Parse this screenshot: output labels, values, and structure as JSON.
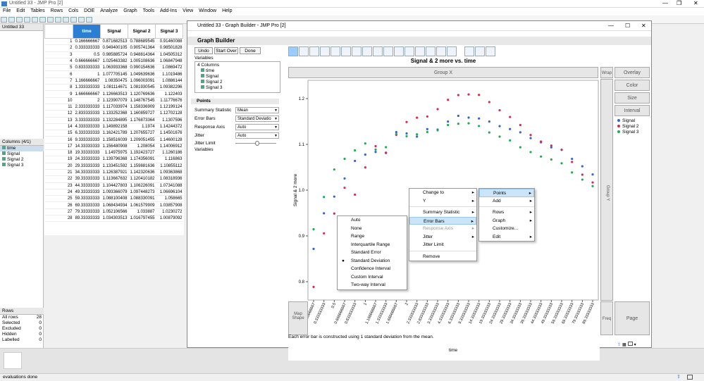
{
  "app": {
    "title": "Untitled 33 - JMP Pro [2]",
    "menus": [
      "File",
      "Edit",
      "Tables",
      "Rows",
      "Cols",
      "DOE",
      "Analyze",
      "Graph",
      "Tools",
      "Add-Ins",
      "View",
      "Window",
      "Help"
    ],
    "status": "evaluations done"
  },
  "left": {
    "table_name": "Untitled 33",
    "columns_header": "Columns (4/1)",
    "columns": [
      "time",
      "Signal",
      "Signal 2",
      "Signal 3"
    ],
    "rows_header": "Rows",
    "rows_stats": [
      {
        "label": "All rows",
        "value": "28"
      },
      {
        "label": "Selected",
        "value": "0"
      },
      {
        "label": "Excluded",
        "value": "0"
      },
      {
        "label": "Hidden",
        "value": "0"
      },
      {
        "label": "Labelled",
        "value": "0"
      }
    ]
  },
  "table": {
    "headers": [
      "time",
      "Signal",
      "Signal 2",
      "Signal 3"
    ],
    "rows": [
      [
        "0.166666667",
        "0.871682513",
        "0.788689545",
        "0.91460088"
      ],
      [
        "0.333333333",
        "0.949400105",
        "0.905741364",
        "0.98501828"
      ],
      [
        "0.5",
        "0.985885724",
        "0.948814364",
        "1.04505312"
      ],
      [
        "0.666666667",
        "1.025463382",
        "1.005108636",
        "1.06847948"
      ],
      [
        "0.833333333",
        "1.063933368",
        "0.990154636",
        "1.0869472"
      ],
      [
        "1",
        "1.077705145",
        "1.049639636",
        "1.1019486"
      ],
      [
        "1.166666667",
        "1.08350475",
        "1.096003091",
        "1.0886144"
      ],
      [
        "1.333333333",
        "1.081114671",
        "1.081930545",
        "1.09382296"
      ],
      [
        "1.666666667",
        "1.126663513",
        "1.120769636",
        "1.122403"
      ],
      [
        "2",
        "1.123907079",
        "1.148767545",
        "1.11776676"
      ],
      [
        "2.333333333",
        "1.117033974",
        "1.158336909",
        "1.12199124"
      ],
      [
        "2.833333333",
        "1.133252368",
        "1.160859727",
        "1.12702128"
      ],
      [
        "3.333333333",
        "1.132284895",
        "1.176873364",
        "1.1307596"
      ],
      [
        "4.333333333",
        "1.149892158",
        "1.1974",
        "1.14244372"
      ],
      [
        "6.333333333",
        "1.162421789",
        "1.207655727",
        "1.14501676"
      ],
      [
        "9.333333333",
        "1.158516039",
        "1.209051455",
        "1.14600128"
      ],
      [
        "14.33333333",
        "1.156480908",
        "1.208054",
        "1.14006912"
      ],
      [
        "19.33333333",
        "1.14975975",
        "1.192423727",
        "1.1260186"
      ],
      [
        "24.33333333",
        "1.139796368",
        "1.174356091",
        "1.116863"
      ],
      [
        "29.33333333",
        "1.133451592",
        "1.159881636",
        "1.10855112"
      ],
      [
        "34.33333333",
        "1.126387921",
        "1.142320636",
        "1.09363868"
      ],
      [
        "39.33333333",
        "1.113667632",
        "1.120410182",
        "1.08318936"
      ],
      [
        "44.33333333",
        "1.104427803",
        "1.106226091",
        "1.07341088"
      ],
      [
        "49.33333333",
        "1.093366079",
        "1.097448273",
        "1.06696104"
      ],
      [
        "59.33333333",
        "1.088100408",
        "1.088330091",
        "1.058665"
      ],
      [
        "69.33333333",
        "1.068434934",
        "1.061579909",
        "1.03857908"
      ],
      [
        "79.33333333",
        "1.052106566",
        "1.033887",
        "1.0230272"
      ],
      [
        "89.33333333",
        "1.034303513",
        "1.016797455",
        "1.00879092"
      ]
    ]
  },
  "gb": {
    "window_title": "Untitled 33 - Graph Builder - JMP Pro [2]",
    "header": "Graph Builder",
    "buttons": [
      "Undo",
      "Start Over",
      "Done"
    ],
    "variables_label": "Variables",
    "columns_label": "4 Columns",
    "var_list": [
      "time",
      "Signal",
      "Signal 2",
      "Signal 3"
    ],
    "points_header": "Points",
    "props": [
      {
        "label": "Summary Statistic",
        "value": "Mean"
      },
      {
        "label": "Error Bars",
        "value": "Standard Deviatio"
      },
      {
        "label": "Response Axis",
        "value": "Auto"
      },
      {
        "label": "Jitter",
        "value": "Auto"
      },
      {
        "label": "Jitter Limit",
        "value": ""
      },
      {
        "label": "Variables",
        "value": ""
      }
    ],
    "chart_title": "Signal & 2 more vs. time",
    "group_x": "Group X",
    "group_y": "Group Y",
    "wrap": "Wrap",
    "freq": "Freq",
    "page": "Page",
    "map_shape": "Map Shape",
    "side_buttons": [
      "Overlay",
      "Color",
      "Size",
      "Interval"
    ],
    "footer_note": "Each error bar is constructed using 1 standard deviation from the mean."
  },
  "chart_data": {
    "type": "scatter",
    "title": "Signal & 2 more vs. time",
    "xlabel": "time",
    "ylabel": "Signal & 2 more",
    "x_categories": [
      "0.166666667",
      "0.333333333",
      "0.5",
      "0.666666667",
      "0.833333333",
      "1",
      "1.166666667",
      "1.333333333",
      "1.666666667",
      "2",
      "2.333333333",
      "2.833333333",
      "3.333333333",
      "4.333333333",
      "6.333333333",
      "9.333333333",
      "14.33333333",
      "19.33333333",
      "24.33333333",
      "29.33333333",
      "34.33333333",
      "39.33333333",
      "44.33333333",
      "49.33333333",
      "59.33333333",
      "69.33333333",
      "79.33333333",
      "89.33333333"
    ],
    "x_tick_labels": [
      "0.166666667",
      "0.333333333",
      "0.5",
      "0.666666667",
      "0.833333333",
      "1",
      "1.166666667",
      "1.333333333",
      "1.666666667",
      "2",
      "2.333333333",
      "2.833333333",
      "3.333333333",
      "4.333333333",
      "6.333333333",
      "9.333333333",
      "14.33333333",
      "19.33333333",
      "24.33333333",
      "29.33333333",
      "34.33333333",
      "39.33333333",
      "44.33333333",
      "49.33333333",
      "59.33333333",
      "69.33333333",
      "79.33333333",
      "89.33333333"
    ],
    "y_ticks": [
      "0.8",
      "0.9",
      "1.0",
      "1.1",
      "1.2"
    ],
    "ylim": [
      0.76,
      1.24
    ],
    "legend_position": "right",
    "series": [
      {
        "name": "Signal",
        "color": "#3366cc",
        "values": [
          0.8717,
          0.9494,
          0.9859,
          1.0255,
          1.0639,
          1.0777,
          1.0835,
          1.0811,
          1.1267,
          1.1239,
          1.117,
          1.1333,
          1.1323,
          1.1499,
          1.1624,
          1.1585,
          1.1565,
          1.1498,
          1.1398,
          1.1335,
          1.1264,
          1.1137,
          1.1044,
          1.0934,
          1.0881,
          1.0684,
          1.0521,
          1.0343
        ]
      },
      {
        "name": "Signal 2",
        "color": "#d42d54",
        "values": [
          0.7887,
          0.9057,
          0.9488,
          1.0051,
          0.9902,
          1.0496,
          1.096,
          1.0819,
          1.1208,
          1.1488,
          1.1583,
          1.1609,
          1.1769,
          1.1974,
          1.2077,
          1.2091,
          1.2081,
          1.1924,
          1.1744,
          1.1599,
          1.1423,
          1.1204,
          1.1062,
          1.0974,
          1.0883,
          1.0616,
          1.0339,
          1.0168
        ]
      },
      {
        "name": "Signal 3",
        "color": "#22aa55",
        "values": [
          0.9146,
          0.985,
          1.0451,
          1.0685,
          1.0869,
          1.1019,
          1.0886,
          1.0938,
          1.1224,
          1.1178,
          1.122,
          1.127,
          1.1308,
          1.1424,
          1.145,
          1.146,
          1.1401,
          1.126,
          1.1169,
          1.1086,
          1.0936,
          1.0832,
          1.0734,
          1.067,
          1.0587,
          1.0386,
          1.023,
          1.0088
        ]
      }
    ]
  },
  "ctx_menu_1": [
    {
      "label": "Auto",
      "state": ""
    },
    {
      "label": "None",
      "state": ""
    },
    {
      "label": "Range",
      "state": ""
    },
    {
      "label": "Interquartile Range",
      "state": ""
    },
    {
      "label": "Standard Error",
      "state": ""
    },
    {
      "label": "Standard Deviation",
      "state": "checked"
    },
    {
      "label": "Confidence Interval",
      "state": ""
    },
    {
      "label": "Custom Interval",
      "state": ""
    },
    {
      "label": "Two-way Interval",
      "state": ""
    }
  ],
  "ctx_menu_2": [
    {
      "label": "Change to",
      "sub": true
    },
    {
      "label": "Y",
      "sub": true
    },
    {
      "label": "Summary Statistic",
      "sub": true
    },
    {
      "label": "Error Bars",
      "sub": true,
      "hl": true
    },
    {
      "label": "Response Axis",
      "sub": true,
      "dis": true
    },
    {
      "label": "Jitter",
      "sub": true
    },
    {
      "label": "Jitter Limit",
      "sub": false
    },
    {
      "label": "Remove",
      "sub": false
    }
  ],
  "ctx_menu_3": [
    {
      "label": "Points",
      "sub": true,
      "hl": true
    },
    {
      "label": "Add",
      "sub": true
    },
    {
      "label": "Rows",
      "sub": true
    },
    {
      "label": "Graph",
      "sub": true
    },
    {
      "label": "Customize...",
      "sub": false
    },
    {
      "label": "Edit",
      "sub": true
    }
  ]
}
